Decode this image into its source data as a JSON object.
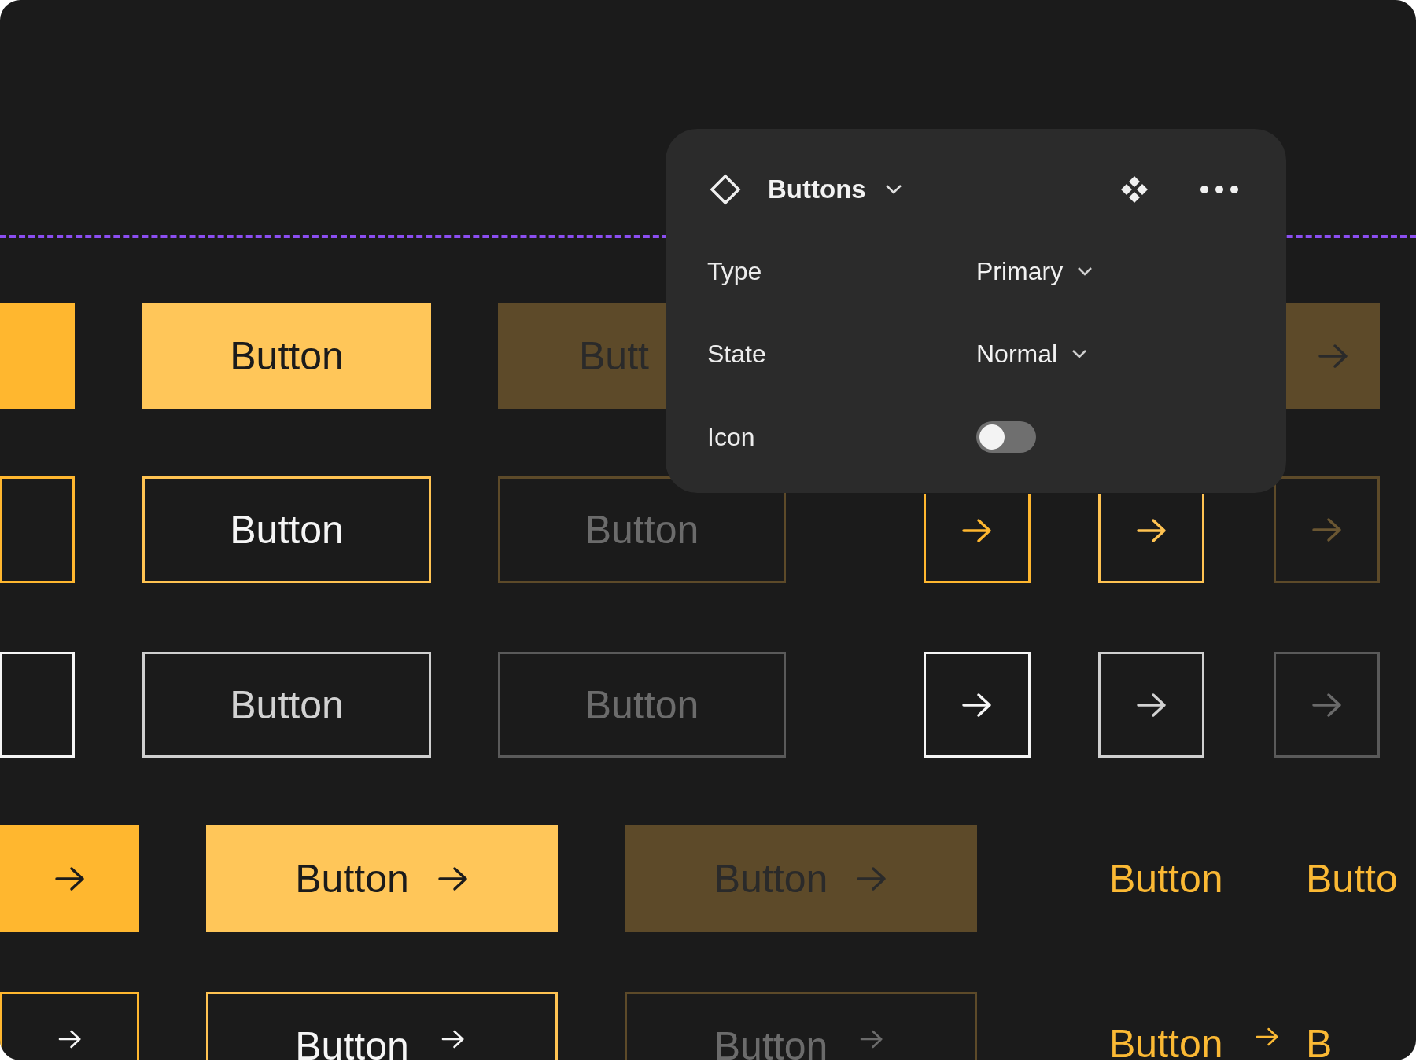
{
  "rows": [
    {
      "kind": "primary",
      "buttons": [
        {
          "hover": true,
          "disabled": false,
          "arrow": false
        },
        {
          "hover": false,
          "disabled": false,
          "label": "Button",
          "arrow": false
        },
        {
          "hover": false,
          "disabled": true,
          "label": "Butt",
          "arrow": false
        },
        {
          "hover": false,
          "disabled": true,
          "arrow": true
        }
      ]
    },
    {
      "kind": "secondary",
      "buttons": [
        {
          "hover": true,
          "disabled": false,
          "arrow": false
        },
        {
          "hover": false,
          "disabled": false,
          "label": "Button",
          "arrow": false
        },
        {
          "hover": false,
          "disabled": true,
          "label": "Button",
          "arrow": false
        },
        {
          "hover": true,
          "disabled": false,
          "arrow": true
        },
        {
          "hover": false,
          "disabled": false,
          "arrow": true
        },
        {
          "hover": false,
          "disabled": true,
          "arrow": true
        }
      ]
    },
    {
      "kind": "tertiary",
      "buttons": [
        {
          "hover": true,
          "disabled": false,
          "arrow": false
        },
        {
          "hover": false,
          "disabled": false,
          "label": "Button",
          "arrow": false
        },
        {
          "hover": false,
          "disabled": true,
          "label": "Button",
          "arrow": false
        },
        {
          "hover": true,
          "disabled": false,
          "arrow": true
        },
        {
          "hover": false,
          "disabled": false,
          "arrow": true
        },
        {
          "hover": false,
          "disabled": true,
          "arrow": true
        }
      ]
    },
    {
      "kind": "primary",
      "buttons": [
        {
          "hover": true,
          "disabled": false,
          "arrow": true
        },
        {
          "hover": false,
          "disabled": false,
          "label": "Button",
          "arrow": true
        },
        {
          "hover": false,
          "disabled": true,
          "label": "Button",
          "arrow": true
        },
        {
          "kind": "text",
          "hover": false,
          "disabled": false,
          "label": "Button",
          "arrow": false
        },
        {
          "kind": "text",
          "hover": false,
          "disabled": false,
          "label": "Butto",
          "arrow": false
        }
      ]
    },
    {
      "kind": "secondary",
      "buttons": [
        {
          "hover": true,
          "disabled": false,
          "arrow": true
        },
        {
          "hover": false,
          "disabled": false,
          "label": "Button",
          "arrow": true
        },
        {
          "hover": false,
          "disabled": true,
          "label": "Button",
          "arrow": true
        },
        {
          "kind": "text",
          "hover": false,
          "disabled": false,
          "label": "Button",
          "arrow": true
        },
        {
          "kind": "text",
          "hover": false,
          "disabled": false,
          "label": "B",
          "arrow": false
        }
      ]
    }
  ],
  "panel": {
    "title": "Buttons",
    "properties": [
      {
        "label": "Type",
        "kind": "select",
        "value": "Primary"
      },
      {
        "label": "State",
        "kind": "select",
        "value": "Normal"
      },
      {
        "label": "Icon",
        "kind": "toggle",
        "on": false
      }
    ]
  }
}
